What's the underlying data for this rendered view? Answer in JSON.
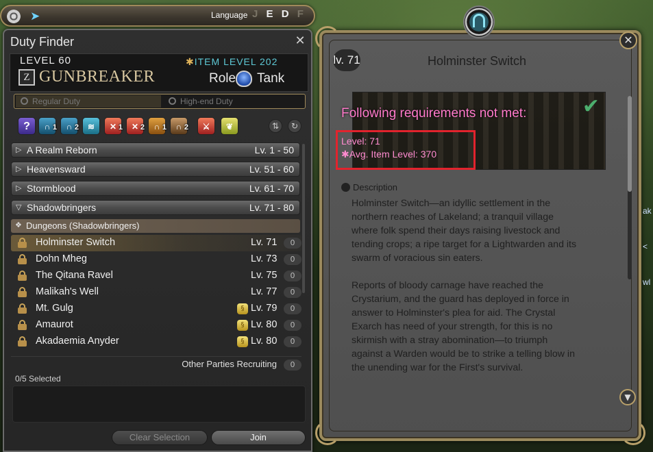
{
  "topbar": {
    "language_label": "Language",
    "language_codes": [
      "J",
      "E",
      "D",
      "F"
    ],
    "active_language": "E"
  },
  "duty_finder": {
    "title": "Duty Finder",
    "level_label": "LEVEL 60",
    "job_name": "GUNBREAKER",
    "item_level_label": "ITEM LEVEL 202",
    "role_label": "Role:",
    "role_name": "Tank",
    "tabs": [
      {
        "label": "Regular Duty",
        "active": true
      },
      {
        "label": "High-end Duty",
        "active": false
      }
    ],
    "category_icons": [
      {
        "icon": "roulette-icon",
        "badge": ""
      },
      {
        "icon": "dungeon-icon",
        "badge": "1"
      },
      {
        "icon": "dungeon-icon",
        "badge": "2"
      },
      {
        "icon": "trial-icon",
        "badge": ""
      },
      {
        "icon": "raid-icon",
        "badge": "1"
      },
      {
        "icon": "raid-icon",
        "badge": "2"
      },
      {
        "icon": "guildhest-icon",
        "badge": "1"
      },
      {
        "icon": "pvp-icon",
        "badge": "2"
      },
      {
        "icon": "crossed-swords-icon",
        "badge": ""
      },
      {
        "icon": "gold-saucer-icon",
        "badge": ""
      }
    ],
    "expansions": [
      {
        "name": "A Realm Reborn",
        "range": "Lv.  1 - 50",
        "expanded": false
      },
      {
        "name": "Heavensward",
        "range": "Lv. 51 - 60",
        "expanded": false
      },
      {
        "name": "Stormblood",
        "range": "Lv. 61 - 70",
        "expanded": false
      },
      {
        "name": "Shadowbringers",
        "range": "Lv. 71 - 80",
        "expanded": true
      }
    ],
    "subheader": "Dungeons (Shadowbringers)",
    "dungeons": [
      {
        "name": "Holminster Switch",
        "level": "Lv. 71",
        "count": "0",
        "tomestone": false,
        "selected": true
      },
      {
        "name": "Dohn Mheg",
        "level": "Lv. 73",
        "count": "0",
        "tomestone": false,
        "selected": false
      },
      {
        "name": "The Qitana Ravel",
        "level": "Lv. 75",
        "count": "0",
        "tomestone": false,
        "selected": false
      },
      {
        "name": "Malikah's Well",
        "level": "Lv. 77",
        "count": "0",
        "tomestone": false,
        "selected": false
      },
      {
        "name": "Mt. Gulg",
        "level": "Lv. 79",
        "count": "0",
        "tomestone": true,
        "selected": false
      },
      {
        "name": "Amaurot",
        "level": "Lv. 80",
        "count": "0",
        "tomestone": true,
        "selected": false
      },
      {
        "name": "Akadaemia Anyder",
        "level": "Lv. 80",
        "count": "0",
        "tomestone": true,
        "selected": false
      }
    ],
    "other_parties_label": "Other Parties Recruiting",
    "other_parties_count": "0",
    "selected_count_label": "0/5 Selected",
    "clear_button": "Clear Selection",
    "join_button": "Join"
  },
  "detail": {
    "level_badge": "lv. 71",
    "title": "Holminster Switch",
    "requirements_title": "Following requirements not met:",
    "requirement_level": "Level: 71",
    "requirement_ilvl": "Avg. Item Level: 370",
    "description_heading": "Description",
    "description": "Holminster Switch—an idyllic settlement in the\nnorthern reaches of Lakeland; a tranquil village\nwhere folk spend their days raising livestock and\ntending crops; a ripe target for a Lightwarden and its\nswarm of voracious sin eaters.\n\nReports of bloody carnage have reached the\nCrystarium, and the guard has deployed in force in\nanswer to Holminster's plea for aid. The Crystal\nExarch has need of your strength, for this is no\nskirmish with a stray abomination—to triumph\nagainst a Warden would be to strike a telling blow in\nthe unending war for the First's survival."
  },
  "right_edge": {
    "text_1": "ak",
    "text_2": "< wl"
  },
  "colors": {
    "requirement_text": "#ff7acb",
    "highlight_box": "#e2232d",
    "frame_gold": "#9b8a5d",
    "item_level_teal": "#5ec9d6"
  }
}
